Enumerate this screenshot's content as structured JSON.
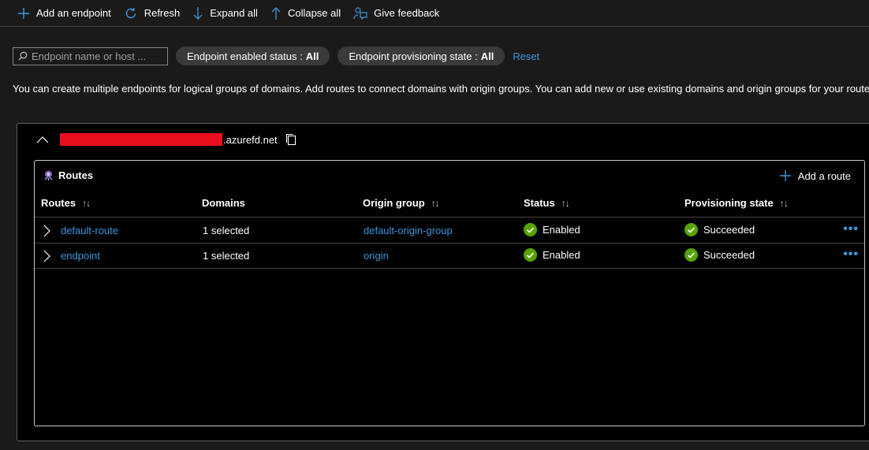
{
  "toolbar": {
    "add_endpoint": "Add an endpoint",
    "refresh": "Refresh",
    "expand_all": "Expand all",
    "collapse_all": "Collapse all",
    "give_feedback": "Give feedback"
  },
  "filters": {
    "search_placeholder": "Endpoint name or host ...",
    "enabled_status_label": "Endpoint enabled status :",
    "enabled_status_value": "All",
    "provisioning_state_label": "Endpoint provisioning state :",
    "provisioning_state_value": "All",
    "reset": "Reset"
  },
  "info_text": "You can create multiple endpoints for logical groups of domains. Add routes to connect domains with origin groups. You can add new or use existing domains and origin groups for your routes.",
  "endpoint": {
    "domain_suffix": ".azurefd.net",
    "routes": {
      "title": "Routes",
      "add_route": "Add a route",
      "columns": {
        "routes": "Routes",
        "domains": "Domains",
        "origin_group": "Origin group",
        "status": "Status",
        "provisioning_state": "Provisioning state"
      },
      "rows": [
        {
          "name": "default-route",
          "domains": "1 selected",
          "origin_group": "default-origin-group",
          "status": "Enabled",
          "provisioning": "Succeeded"
        },
        {
          "name": "endpoint",
          "domains": "1 selected",
          "origin_group": "origin",
          "status": "Enabled",
          "provisioning": "Succeeded"
        }
      ]
    }
  },
  "icons": {
    "add": "add-icon",
    "refresh": "refresh-icon",
    "expand": "arrow-down-icon",
    "collapse": "arrow-up-icon",
    "feedback": "feedback-icon",
    "copy": "copy-icon",
    "success": "check-circle-icon"
  },
  "colors": {
    "accent": "#3a96dd",
    "success": "#57a300",
    "redaction": "#e8101e"
  }
}
